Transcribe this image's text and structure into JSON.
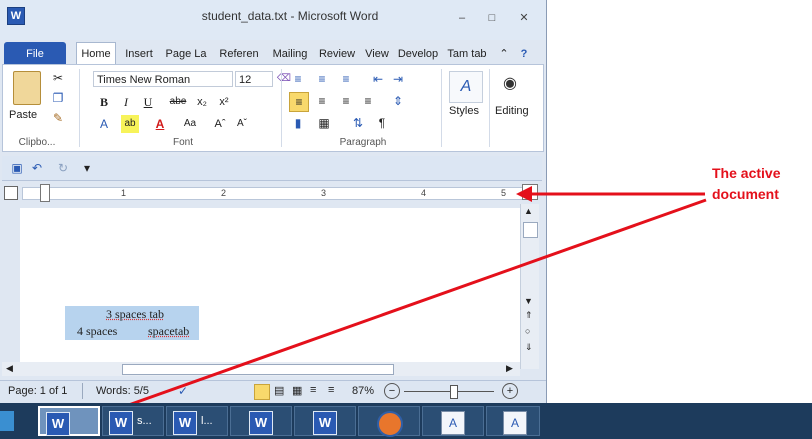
{
  "window": {
    "app_icon": "W",
    "title": "student_data.txt - Microsoft Word",
    "controls": {
      "minimize": "–",
      "maximize": "□",
      "close": "✕"
    }
  },
  "ribbon_tabs": [
    "File",
    "Home",
    "Insert",
    "Page La",
    "Referen",
    "Mailing",
    "Review",
    "View",
    "Develop",
    "Tam tab"
  ],
  "ribbon": {
    "clipboard": {
      "paste_label": "Paste",
      "group_label": "Clipbo..."
    },
    "font": {
      "font_name": "Times New Roman",
      "font_size": "12",
      "bold": "B",
      "italic": "I",
      "underline": "U",
      "strike": "abe",
      "subscript": "x₂",
      "superscript": "x²",
      "grow": "Aˆ",
      "shrink": "Aˇ",
      "case": "Aa",
      "group_label": "Font"
    },
    "paragraph": {
      "show_marks": "¶",
      "group_label": "Paragraph"
    },
    "styles": {
      "label": "Styles"
    },
    "editing": {
      "label": "Editing"
    }
  },
  "ruler": {
    "numbers": [
      "1",
      "2",
      "3",
      "4",
      "5"
    ]
  },
  "document": {
    "line1": "3 spaces tab",
    "line2_part1": "4 spaces",
    "line2_part2": "spacetab"
  },
  "status_bar": {
    "page": "Page: 1 of 1",
    "words": "Words: 5/5",
    "zoom": "87%",
    "zoom_out": "−",
    "zoom_in": "+"
  },
  "taskbar": {
    "items": [
      {
        "label": ""
      },
      {
        "label": "s..."
      },
      {
        "label": "l..."
      },
      {
        "label": ""
      },
      {
        "label": ""
      }
    ]
  },
  "annotation": {
    "text_line1": "The active",
    "text_line2": "document"
  },
  "colors": {
    "accent": "#2a5ab3",
    "annotation": "#e4101b",
    "selection": "#b7d3ee"
  }
}
